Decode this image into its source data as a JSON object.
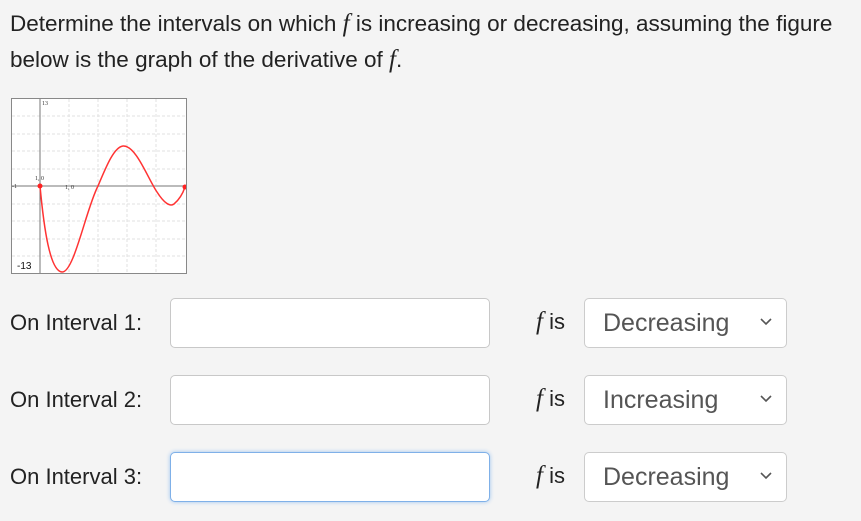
{
  "question": {
    "before": "Determine the intervals on which ",
    "f": "f",
    "after": " is increasing or decreasing, assuming the figure below is the graph of the derivative of ",
    "f2": "f",
    "end": "."
  },
  "graph": {
    "labels": {
      "ymax": "13",
      "ymin": "-13",
      "xmin": "-1",
      "point1": "1, 0",
      "point2": "1, 0"
    },
    "curve_color": "#ff3333"
  },
  "rows": [
    {
      "label": "On Interval 1:",
      "value": "",
      "f": "f",
      "is": " is",
      "selected": "Decreasing"
    },
    {
      "label": "On Interval 2:",
      "value": "",
      "f": "f",
      "is": " is",
      "selected": "Increasing"
    },
    {
      "label": "On Interval 3:",
      "value": "",
      "f": "f",
      "is": " is",
      "selected": "Decreasing"
    }
  ]
}
